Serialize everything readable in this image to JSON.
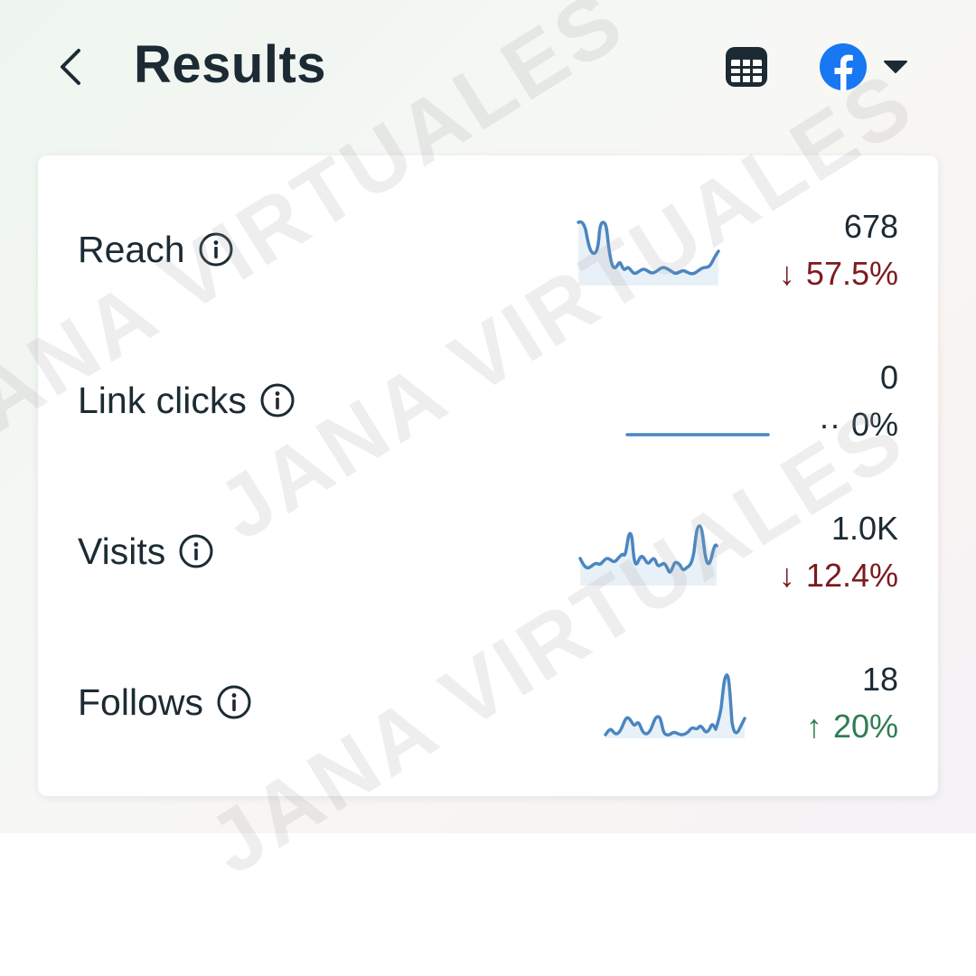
{
  "header": {
    "title": "Results",
    "back_icon": "chevron-left-icon",
    "calendar_icon": "calendar-icon",
    "platform_icon": "facebook-icon",
    "dropdown_icon": "caret-down-icon"
  },
  "metrics": [
    {
      "label": "Reach",
      "value": "678",
      "change_arrow": "↓",
      "change": "57.5%",
      "trend": "down"
    },
    {
      "label": "Link clicks",
      "value": "0",
      "change_arrow": "··",
      "change": "0%",
      "trend": "flat"
    },
    {
      "label": "Visits",
      "value": "1.0K",
      "change_arrow": "↓",
      "change": "12.4%",
      "trend": "down"
    },
    {
      "label": "Follows",
      "value": "18",
      "change_arrow": "↑",
      "change": "20%",
      "trend": "up"
    }
  ],
  "watermark": "JANA VIRTUALES",
  "colors": {
    "title": "#1c2b33",
    "sparkline": "#4a86c0",
    "sparkline_fill": "#e9f1f8",
    "down": "#7c1a1e",
    "up": "#2e7d54",
    "facebook": "#1877f2"
  }
}
